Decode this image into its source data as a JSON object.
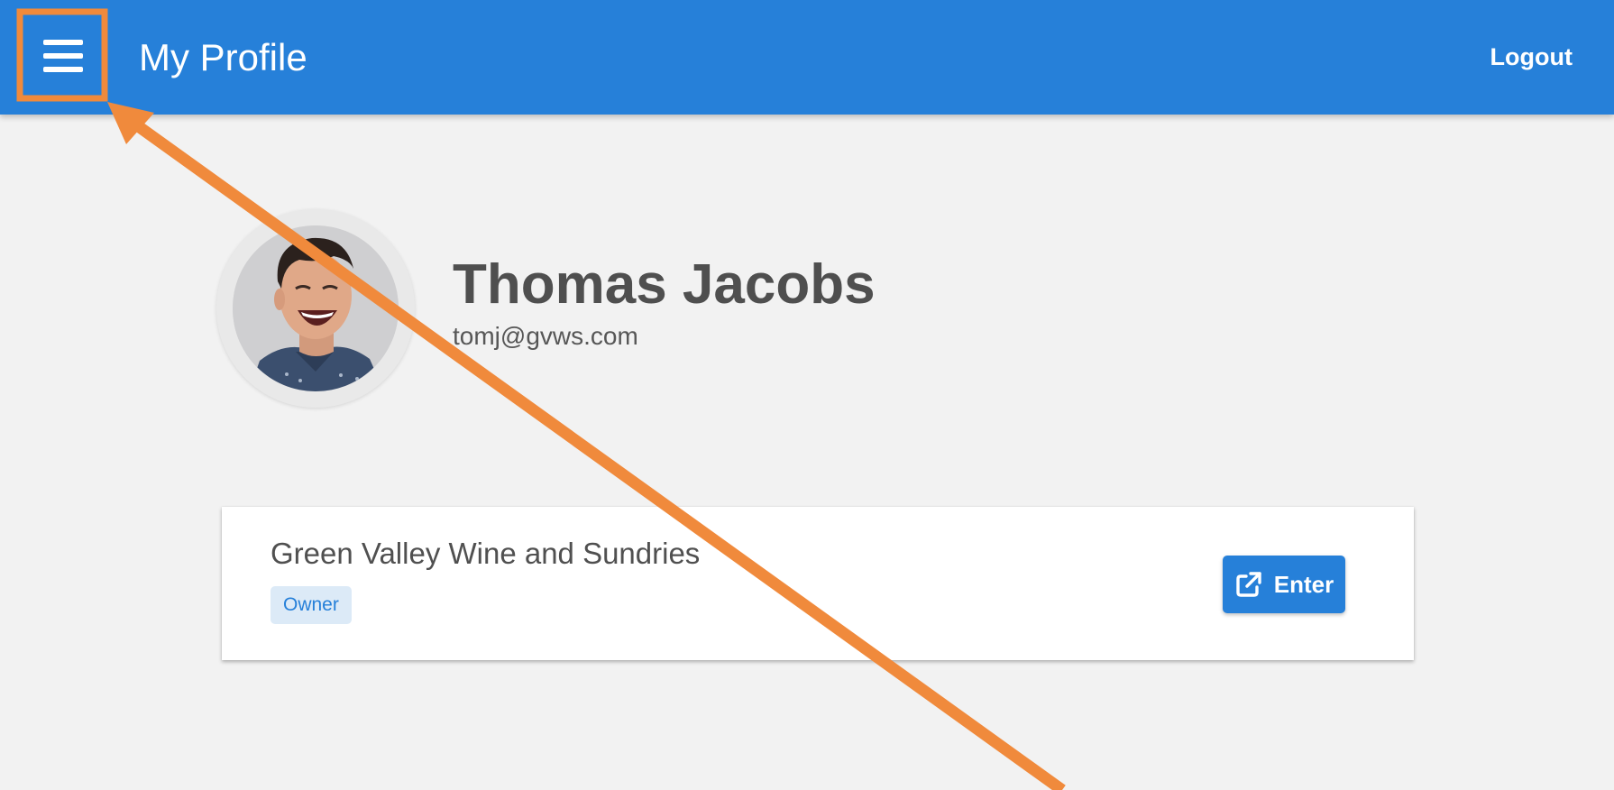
{
  "appbar": {
    "title": "My Profile",
    "logout_label": "Logout",
    "color": "#2680d9"
  },
  "profile": {
    "name": "Thomas Jacobs",
    "email": "tomj@gvws.com"
  },
  "organization": {
    "name": "Green Valley Wine and Sundries",
    "role": "Owner",
    "enter_label": "Enter"
  },
  "icons": {
    "menu": "hamburger-menu-icon",
    "enter": "external-link-icon"
  },
  "annotation": {
    "color": "#f08a3c",
    "target": "menu-button"
  }
}
